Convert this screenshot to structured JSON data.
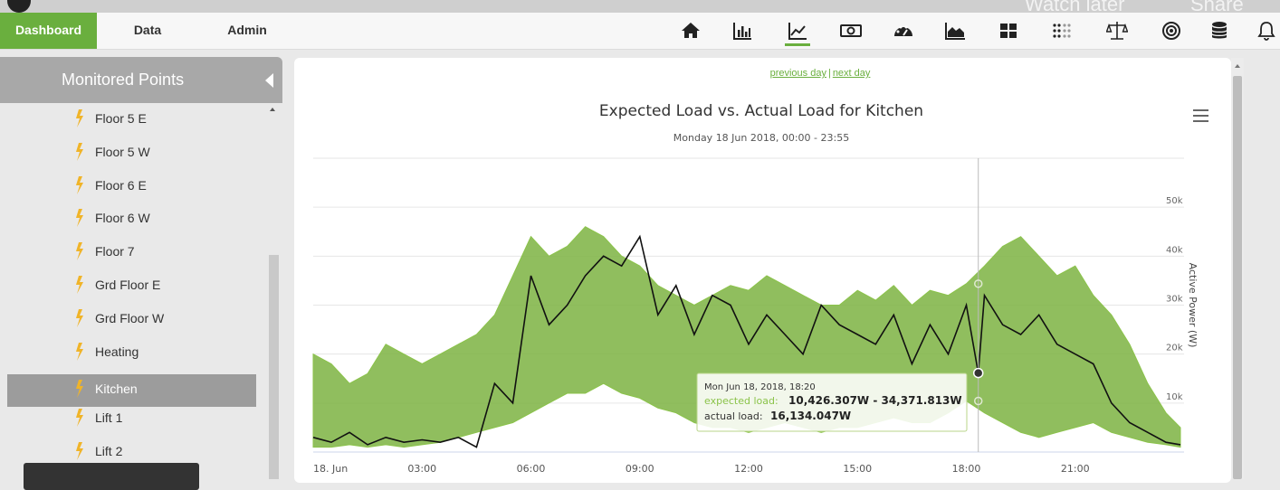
{
  "overlay": {
    "watch_later": "Watch later",
    "share": "Share"
  },
  "nav": {
    "tabs": [
      {
        "label": "Dashboard",
        "active": true
      },
      {
        "label": "Data",
        "active": false
      },
      {
        "label": "Admin",
        "active": false
      }
    ],
    "icons": [
      "home-icon",
      "bar-chart-icon",
      "line-chart-icon",
      "money-icon",
      "gauge-icon",
      "area-chart-icon",
      "dashboard-grid-icon",
      "dot-matrix-icon",
      "balance-scale-icon",
      "target-icon",
      "database-icon",
      "bell-icon"
    ],
    "accent": "#6aaf3e"
  },
  "sidebar": {
    "title": "Monitored Points",
    "items": [
      {
        "label": "Floor 5 E",
        "selected": false
      },
      {
        "label": "Floor 5 W",
        "selected": false
      },
      {
        "label": "Floor 6 E",
        "selected": false
      },
      {
        "label": "Floor 6 W",
        "selected": false
      },
      {
        "label": "Floor 7",
        "selected": false
      },
      {
        "label": "Grd Floor E",
        "selected": false
      },
      {
        "label": "Grd Floor W",
        "selected": false
      },
      {
        "label": "Heating",
        "selected": false
      },
      {
        "label": "Kitchen",
        "selected": true
      },
      {
        "label": "Lift 1",
        "selected": false
      },
      {
        "label": "Lift 2",
        "selected": false
      }
    ]
  },
  "chart_nav": {
    "previous": "previous day",
    "separator": "|",
    "next": "next day"
  },
  "chart_data": {
    "type": "area",
    "title": "Expected Load vs. Actual Load for Kitchen",
    "subtitle": "Monday 18 Jun 2018, 00:00 - 23:55",
    "xlabel": "",
    "ylabel": "Active Power (W)",
    "x_ticks": [
      "18. Jun",
      "03:00",
      "06:00",
      "09:00",
      "12:00",
      "15:00",
      "18:00",
      "21:00"
    ],
    "y_ticks": [
      "10k",
      "20k",
      "30k",
      "40k",
      "50k"
    ],
    "ylim": [
      0,
      60000
    ],
    "xlim": [
      "00:00",
      "23:55"
    ],
    "series": [
      {
        "name": "expected load",
        "kind": "range",
        "color": "#7cb342",
        "x_hours": [
          0,
          0.5,
          1,
          1.5,
          2,
          2.5,
          3,
          3.5,
          4,
          4.5,
          5,
          5.5,
          6,
          6.5,
          7,
          7.5,
          8,
          8.5,
          9,
          9.5,
          10,
          10.5,
          11,
          11.5,
          12,
          12.5,
          13,
          13.5,
          14,
          14.5,
          15,
          15.5,
          16,
          16.5,
          17,
          17.5,
          18,
          18.5,
          19,
          19.5,
          20,
          20.5,
          21,
          21.5,
          22,
          22.5,
          23,
          23.5,
          23.9
        ],
        "low": [
          1000,
          1000,
          1500,
          1000,
          1500,
          1000,
          1500,
          2000,
          3000,
          4000,
          5000,
          6000,
          8000,
          10000,
          12000,
          12000,
          14000,
          12000,
          11000,
          9000,
          8000,
          6000,
          5000,
          5000,
          4000,
          5000,
          6000,
          5000,
          4000,
          5000,
          5000,
          6000,
          7000,
          6000,
          6000,
          8000,
          10426,
          8000,
          6000,
          4000,
          3000,
          4000,
          5000,
          6000,
          4000,
          3000,
          2000,
          1500,
          1000
        ],
        "high": [
          20000,
          18000,
          14000,
          16000,
          22000,
          20000,
          18000,
          20000,
          22000,
          24000,
          28000,
          36000,
          44000,
          40000,
          42000,
          46000,
          44000,
          40000,
          38000,
          34000,
          32000,
          30000,
          32000,
          34000,
          33000,
          36000,
          34000,
          32000,
          30000,
          30000,
          33000,
          31000,
          34000,
          30000,
          33000,
          32000,
          34371,
          38000,
          42000,
          44000,
          40000,
          36000,
          38000,
          32000,
          28000,
          22000,
          14000,
          8000,
          5000
        ]
      },
      {
        "name": "actual load",
        "kind": "line",
        "color": "#111111",
        "x_hours": [
          0,
          0.5,
          1,
          1.5,
          2,
          2.5,
          3,
          3.5,
          4,
          4.5,
          5,
          5.5,
          6,
          6.5,
          7,
          7.5,
          8,
          8.5,
          9,
          9.5,
          10,
          10.5,
          11,
          11.5,
          12,
          12.5,
          13,
          13.5,
          14,
          14.5,
          15,
          15.5,
          16,
          16.5,
          17,
          17.5,
          18,
          18.33,
          18.5,
          19,
          19.5,
          20,
          20.5,
          21,
          21.5,
          22,
          22.5,
          23,
          23.5,
          23.9
        ],
        "values": [
          3000,
          2000,
          4000,
          1500,
          3000,
          2000,
          2500,
          2000,
          3000,
          1000,
          14000,
          10000,
          36000,
          26000,
          30000,
          36000,
          40000,
          38000,
          44000,
          28000,
          34000,
          24000,
          32000,
          30000,
          22000,
          28000,
          24000,
          20000,
          30000,
          26000,
          24000,
          22000,
          28000,
          18000,
          26000,
          20000,
          30000,
          16134,
          32000,
          26000,
          24000,
          28000,
          22000,
          20000,
          18000,
          10000,
          6000,
          4000,
          2000,
          1500
        ]
      }
    ],
    "tooltip": {
      "header": "Mon Jun 18, 2018, 18:20",
      "expected_label": "expected load:",
      "expected_value": "10,426.307W - 34,371.813W",
      "actual_label": "actual load:",
      "actual_value": "16,134.047W"
    },
    "crosshair_hour": 18.33,
    "grid": true,
    "legend": "none"
  }
}
